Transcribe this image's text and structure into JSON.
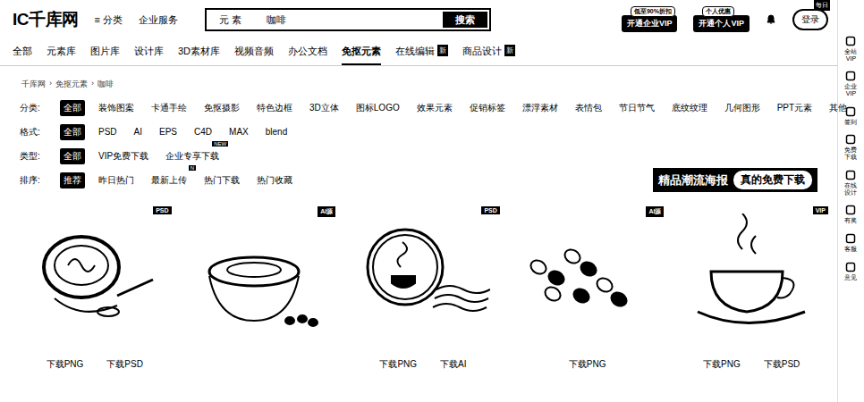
{
  "header": {
    "logo": "IC千库网",
    "menu": [
      {
        "label": "分类",
        "icon": "≡"
      },
      {
        "label": "企业服务",
        "icon": ""
      }
    ],
    "search": {
      "scope": "元 素",
      "value": "咖啡",
      "button": "搜索"
    },
    "vip": [
      {
        "badge": "低至90%折扣",
        "label": "开通企业VIP"
      },
      {
        "badge": "个人优惠",
        "label": "开通个人VIP"
      }
    ],
    "login": {
      "badge": "每日",
      "label": "登录"
    }
  },
  "nav": [
    {
      "label": "全部",
      "selected": false,
      "badge": ""
    },
    {
      "label": "元素库",
      "selected": false,
      "badge": ""
    },
    {
      "label": "图片库",
      "selected": false,
      "badge": ""
    },
    {
      "label": "设计库",
      "selected": false,
      "badge": ""
    },
    {
      "label": "3D素材库",
      "selected": false,
      "badge": ""
    },
    {
      "label": "视频音频",
      "selected": false,
      "badge": ""
    },
    {
      "label": "办公文档",
      "selected": false,
      "badge": ""
    },
    {
      "label": "免抠元素",
      "selected": true,
      "badge": ""
    },
    {
      "label": "在线编辑",
      "selected": false,
      "badge": "新"
    },
    {
      "label": "商品设计",
      "selected": false,
      "badge": "新"
    }
  ],
  "breadcrumb": [
    "千库网",
    "免抠元素",
    "咖啡"
  ],
  "filters": [
    {
      "label": "分类:",
      "options": [
        {
          "text": "全部",
          "selected": true,
          "badge": ""
        },
        {
          "text": "装饰图案",
          "selected": false,
          "badge": ""
        },
        {
          "text": "卡通手绘",
          "selected": false,
          "badge": ""
        },
        {
          "text": "免抠摄影",
          "selected": false,
          "badge": ""
        },
        {
          "text": "特色边框",
          "selected": false,
          "badge": ""
        },
        {
          "text": "3D立体",
          "selected": false,
          "badge": ""
        },
        {
          "text": "图标LOGO",
          "selected": false,
          "badge": ""
        },
        {
          "text": "效果元素",
          "selected": false,
          "badge": ""
        },
        {
          "text": "促销标签",
          "selected": false,
          "badge": ""
        },
        {
          "text": "漂浮素材",
          "selected": false,
          "badge": ""
        },
        {
          "text": "表情包",
          "selected": false,
          "badge": ""
        },
        {
          "text": "节日节气",
          "selected": false,
          "badge": ""
        },
        {
          "text": "底纹纹理",
          "selected": false,
          "badge": ""
        },
        {
          "text": "几何图形",
          "selected": false,
          "badge": ""
        },
        {
          "text": "PPT元素",
          "selected": false,
          "badge": ""
        },
        {
          "text": "其他",
          "selected": false,
          "badge": ""
        }
      ]
    },
    {
      "label": "格式:",
      "options": [
        {
          "text": "全部",
          "selected": true,
          "badge": ""
        },
        {
          "text": "PSD",
          "selected": false,
          "badge": ""
        },
        {
          "text": "AI",
          "selected": false,
          "badge": ""
        },
        {
          "text": "EPS",
          "selected": false,
          "badge": ""
        },
        {
          "text": "C4D",
          "selected": false,
          "badge": ""
        },
        {
          "text": "MAX",
          "selected": false,
          "badge": ""
        },
        {
          "text": "blend",
          "selected": false,
          "badge": ""
        }
      ]
    },
    {
      "label": "类型:",
      "options": [
        {
          "text": "全部",
          "selected": true,
          "badge": ""
        },
        {
          "text": "VIP免费下载",
          "selected": false,
          "badge": ""
        },
        {
          "text": "企业专享下载",
          "selected": false,
          "badge": "NEW"
        }
      ]
    },
    {
      "label": "排序:",
      "options": [
        {
          "text": "推荐",
          "selected": true,
          "badge": ""
        },
        {
          "text": "昨日热门",
          "selected": false,
          "badge": ""
        },
        {
          "text": "最新上传",
          "selected": false,
          "badge": "N"
        },
        {
          "text": "热门下载",
          "selected": false,
          "badge": ""
        },
        {
          "text": "热门收藏",
          "selected": false,
          "badge": ""
        }
      ]
    }
  ],
  "banner": {
    "title": "精品潮流海报",
    "action": "真的免费下载"
  },
  "cards": [
    {
      "kind": "latte",
      "tag": "PSD",
      "links": [
        "下载PNG",
        "下载PSD"
      ]
    },
    {
      "kind": "bowl",
      "tag": "AI源",
      "links": []
    },
    {
      "kind": "emblem",
      "tag": "PSD",
      "links": [
        "下载PNG",
        "下载AI"
      ]
    },
    {
      "kind": "beans",
      "tag": "AI源",
      "links": [
        "下载PNG"
      ]
    },
    {
      "kind": "steam",
      "tag": "VIP",
      "links": [
        "下载PNG",
        "下载PSD"
      ]
    }
  ],
  "sidebar": [
    "全站VIP",
    "企业VIP",
    "签到",
    "免费下载",
    "在线设计",
    "有奖",
    "客服",
    "意见"
  ]
}
